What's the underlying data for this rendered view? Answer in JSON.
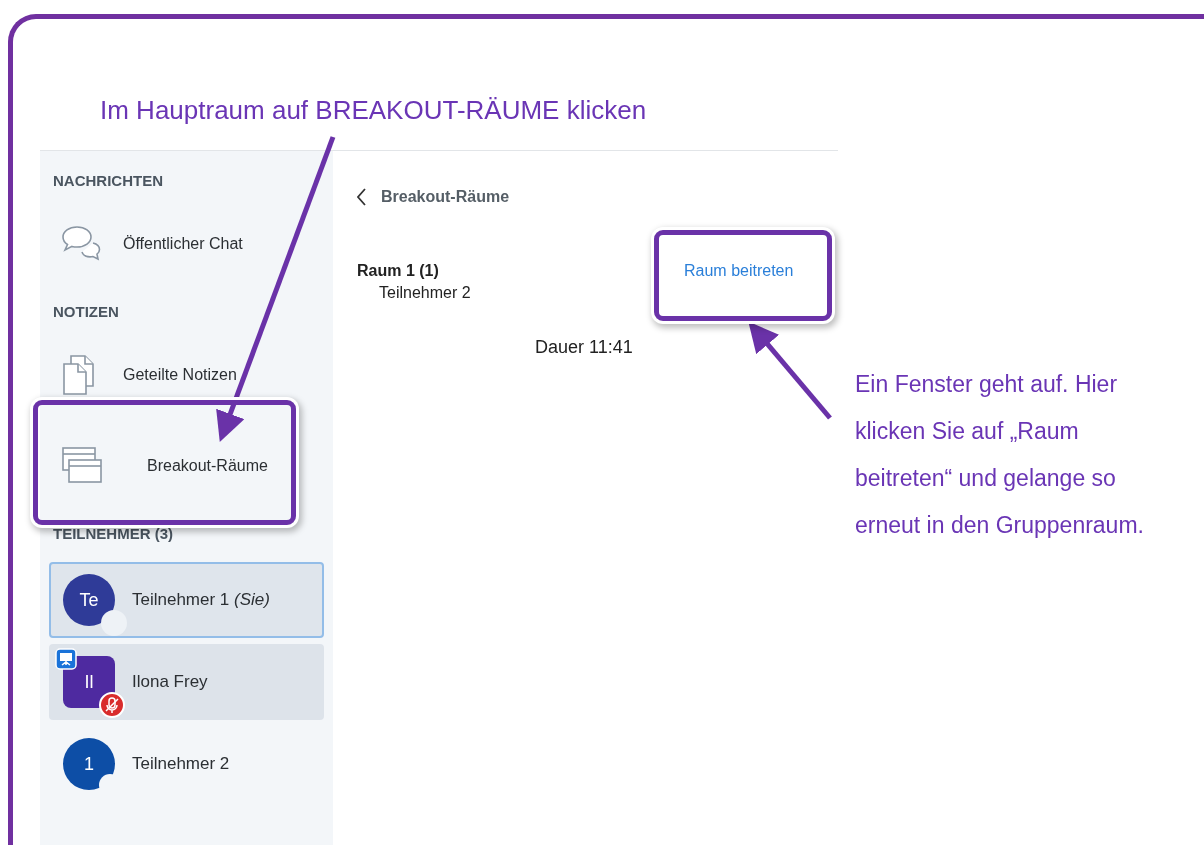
{
  "annotation_title": "Im Hauptraum auf BREAKOUT-RÄUME klicken",
  "sidebar": {
    "sections": [
      {
        "heading": "NACHRICHTEN",
        "items": [
          {
            "kind": "chat",
            "label": "Öffentlicher Chat",
            "highlighted": false
          }
        ]
      },
      {
        "heading": "NOTIZEN",
        "items": [
          {
            "kind": "notes",
            "label": "Geteilte Notizen",
            "highlighted": false
          }
        ]
      },
      {
        "items": [
          {
            "kind": "breakout",
            "label": "Breakout-Räume",
            "highlighted": true
          }
        ]
      }
    ],
    "participants_heading": "TEILNEHMER (3)",
    "participants": [
      {
        "initials": "Te",
        "name": "Teilnehmer 1 *(Sie)*",
        "kind": "circle",
        "color": "#2f3b98",
        "selected": true,
        "hovered": false,
        "presenter": false,
        "muted": false,
        "talking_dot": true
      },
      {
        "initials": "Il",
        "name": "Ilona Frey",
        "kind": "square",
        "color": "#4e2aa0",
        "selected": false,
        "hovered": true,
        "presenter": true,
        "muted": true,
        "talking_dot": false
      },
      {
        "initials": "1",
        "name": "Teilnehmer 2",
        "kind": "circle",
        "color": "#0d4ea6",
        "selected": false,
        "hovered": false,
        "presenter": false,
        "muted": false,
        "talking_dot": false
      }
    ]
  },
  "breakout_panel": {
    "title": "Breakout-Räume",
    "rooms": [
      {
        "name": "Raum 1 (1)",
        "members": [
          "Teilnehmer 2"
        ],
        "action": "Raum beitreten",
        "highlighted": true
      }
    ],
    "duration": "Dauer 11:41"
  },
  "callout": "Ein Fenster geht auf. Hier klicken Sie auf „Raum beitreten“ und gelange so erneut in den Gruppenraum."
}
